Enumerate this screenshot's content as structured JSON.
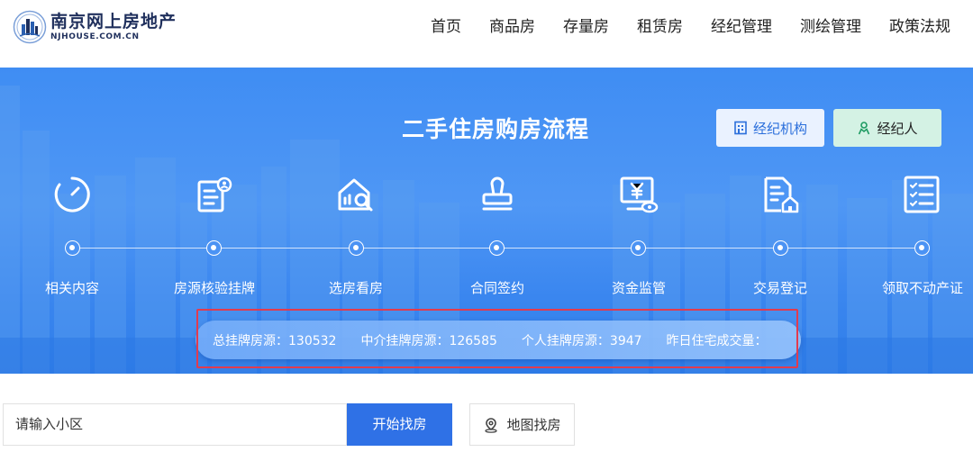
{
  "logo": {
    "title": "南京网上房地产",
    "subtitle": "NJHOUSE.COM.CN"
  },
  "nav": [
    "首页",
    "商品房",
    "存量房",
    "租赁房",
    "经纪管理",
    "测绘管理",
    "政策法规"
  ],
  "banner": {
    "title": "二手住房购房流程",
    "agency_button": "经纪机构",
    "agent_button": "经纪人",
    "steps": [
      {
        "label": "相关内容",
        "icon": "clock-icon"
      },
      {
        "label": "房源核验挂牌",
        "icon": "document-verify-icon"
      },
      {
        "label": "选房看房",
        "icon": "house-search-icon"
      },
      {
        "label": "合同签约",
        "icon": "stamp-icon"
      },
      {
        "label": "资金监管",
        "icon": "fund-monitor-icon"
      },
      {
        "label": "交易登记",
        "icon": "house-document-icon"
      },
      {
        "label": "领取不动产证",
        "icon": "checklist-icon"
      }
    ],
    "stats": [
      "总挂牌房源：130532",
      "中介挂牌房源：126585",
      "个人挂牌房源：3947",
      "昨日住宅成交量："
    ]
  },
  "search": {
    "placeholder": "请输入小区",
    "button": "开始找房",
    "map_button": "地图找房"
  },
  "colors": {
    "banner": "#3f8df3",
    "search_button": "#2f71e6",
    "highlight_frame": "#e23b4e"
  }
}
